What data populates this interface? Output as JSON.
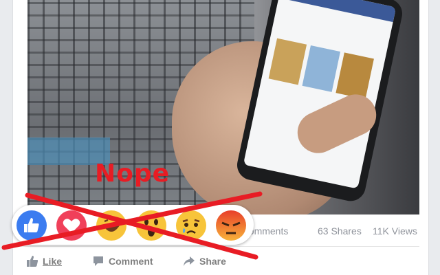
{
  "post": {
    "stats": {
      "comments": "9 Comments",
      "shares": "63 Shares",
      "views": "11K Views"
    },
    "actions": {
      "like": "Like",
      "comment": "Comment",
      "share": "Share"
    }
  },
  "overlay": {
    "caption": "Nope",
    "caption_color": "#e81c24",
    "cross_color": "#e81c24"
  },
  "reactions": [
    {
      "name": "like",
      "color": "#3b7cf0"
    },
    {
      "name": "love",
      "color": "#f0405a"
    },
    {
      "name": "haha",
      "color": "#f7c43a"
    },
    {
      "name": "wow",
      "color": "#f7c43a"
    },
    {
      "name": "sad",
      "color": "#f7c43a"
    },
    {
      "name": "angry",
      "color": "#f05a28"
    }
  ]
}
